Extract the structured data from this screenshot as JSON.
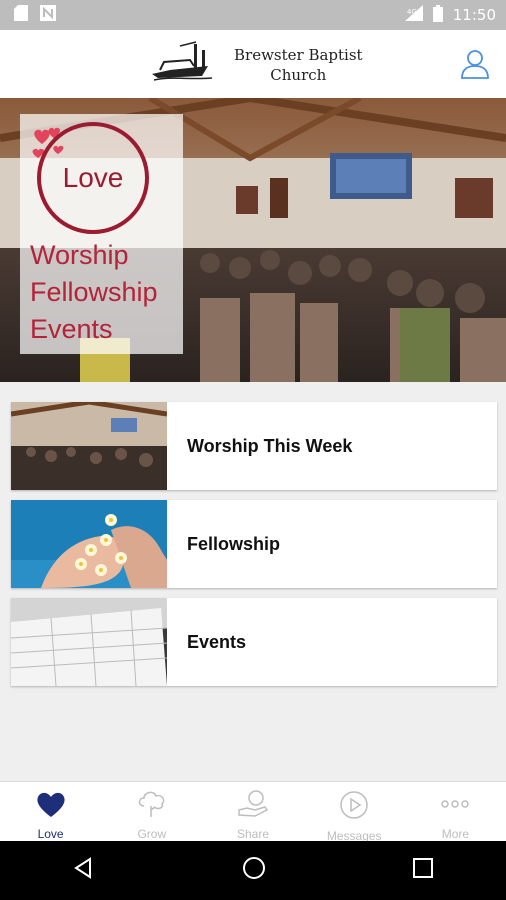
{
  "status_bar": {
    "time": "11:50"
  },
  "header": {
    "church_name_line1": "Brewster Baptist",
    "church_name_line2": "Church"
  },
  "hero": {
    "circle_text": "Love",
    "lines": [
      "Worship",
      "Fellowship",
      "Events"
    ]
  },
  "list": [
    {
      "label": "Worship This Week"
    },
    {
      "label": "Fellowship"
    },
    {
      "label": "Events"
    }
  ],
  "tabs": [
    {
      "label": "Love",
      "icon": "heart-icon",
      "active": true
    },
    {
      "label": "Grow",
      "icon": "tree-icon",
      "active": false
    },
    {
      "label": "Share",
      "icon": "share-hand-icon",
      "active": false
    },
    {
      "label": "Messages",
      "icon": "play-icon",
      "active": false
    },
    {
      "label": "More",
      "icon": "more-icon",
      "active": false
    }
  ],
  "colors": {
    "accent": "#1e2f7a",
    "brand_red": "#9b1b30",
    "inactive": "#bdbdbd"
  }
}
